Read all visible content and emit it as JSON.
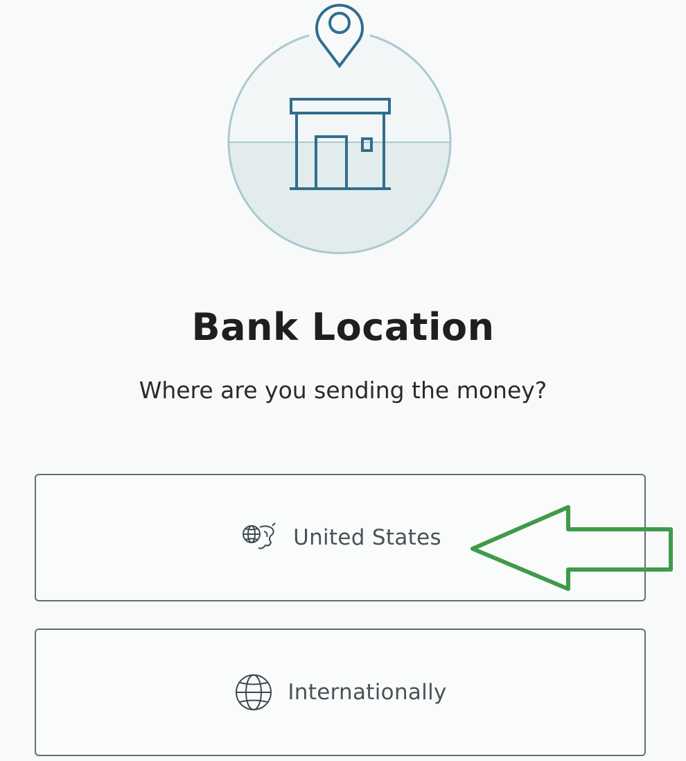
{
  "header": {
    "title": "Bank Location",
    "subtitle": "Where are you sending the money?"
  },
  "illustration": {
    "icon": "bank-location-illustration",
    "accent_color": "#2f6e8f",
    "circle_color": "#aac9cf"
  },
  "options": [
    {
      "label": "United States",
      "icon": "us-globe-icon"
    },
    {
      "label": "Internationally",
      "icon": "globe-icon"
    }
  ],
  "annotation": {
    "icon": "left-arrow-annotation",
    "color": "#3f9a4a"
  }
}
